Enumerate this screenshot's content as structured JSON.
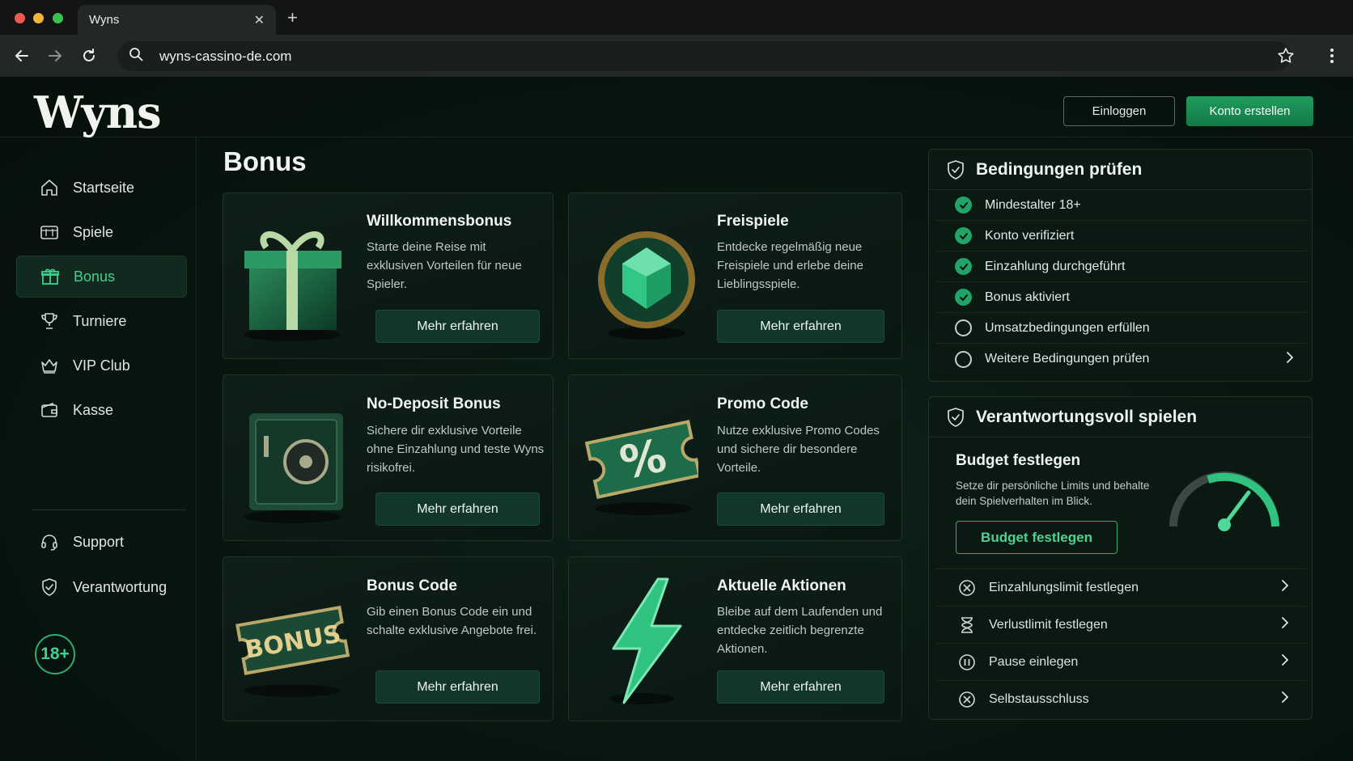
{
  "browser": {
    "tab_title": "Wyns",
    "tab_close": "✕",
    "tab_new": "+",
    "url": "wyns-cassino-de.com"
  },
  "header": {
    "logo": "Wyns",
    "login_label": "Einloggen",
    "signup_label": "Konto erstellen"
  },
  "sidebar": {
    "items": [
      {
        "label": "Startseite",
        "icon": "home-icon"
      },
      {
        "label": "Spiele",
        "icon": "slot-machine-icon"
      },
      {
        "label": "Bonus",
        "icon": "gift-icon",
        "active": true
      },
      {
        "label": "Turniere",
        "icon": "trophy-icon"
      },
      {
        "label": "VIP Club",
        "icon": "crown-icon"
      },
      {
        "label": "Kasse",
        "icon": "wallet-icon"
      },
      {
        "label": "Support",
        "icon": "headset-icon"
      },
      {
        "label": "Verantwortung",
        "icon": "shield-icon"
      }
    ],
    "age_badge": "18+"
  },
  "main": {
    "title": "Bonus",
    "cards": [
      {
        "title": "Willkommensbonus",
        "desc": "Starte deine Reise mit exklusiven Vorteilen für neue Spieler.",
        "button": "Mehr erfahren",
        "art": "gift-box-icon"
      },
      {
        "title": "Freispiele",
        "desc": "Entdecke regelmäßig neue Freispiele und erlebe deine Lieblingsspiele.",
        "button": "Mehr erfahren",
        "art": "emerald-coin-icon"
      },
      {
        "title": "No-Deposit Bonus",
        "desc": "Sichere dir exklusive Vorteile ohne Einzahlung und teste Wyns risikofrei.",
        "button": "Mehr erfahren",
        "art": "safe-icon"
      },
      {
        "title": "Promo Code",
        "desc": "Nutze exklusive Promo Codes und sichere dir besondere Vorteile.",
        "button": "Mehr erfahren",
        "art": "percent-ticket-icon"
      },
      {
        "title": "Bonus Code",
        "desc": "Gib einen Bonus Code ein und schalte exklusive Angebote frei.",
        "button": "Mehr erfahren",
        "art": "bonus-ticket-icon",
        "art_text": "BONUS"
      },
      {
        "title": "Aktuelle Aktionen",
        "desc": "Bleibe auf dem Laufenden und entdecke zeitlich begrenzte Aktionen.",
        "button": "Mehr erfahren",
        "art": "lightning-icon"
      }
    ]
  },
  "conditions": {
    "title": "Bedingungen prüfen",
    "items": [
      {
        "label": "Mindestalter 18+",
        "done": true
      },
      {
        "label": "Konto verifiziert",
        "done": true
      },
      {
        "label": "Einzahlung durchgeführt",
        "done": true
      },
      {
        "label": "Bonus aktiviert",
        "done": true
      },
      {
        "label": "Umsatzbedingungen erfüllen",
        "done": false
      },
      {
        "label": "Weitere Bedingungen prüfen",
        "done": false
      }
    ]
  },
  "responsible": {
    "title": "Verantwortungsvoll spielen",
    "budget_title": "Budget festlegen",
    "budget_desc": "Setze dir persönliche Limits und behalte dein Spielverhalten im Blick.",
    "budget_button": "Budget festlegen",
    "items": [
      {
        "label": "Einzahlungslimit festlegen",
        "icon": "limit-icon"
      },
      {
        "label": "Verlustlimit festlegen",
        "icon": "hourglass-icon"
      },
      {
        "label": "Pause einlegen",
        "icon": "pause-icon"
      },
      {
        "label": "Selbstausschluss",
        "icon": "exclusion-icon"
      }
    ]
  },
  "colors": {
    "accent": "#22a468",
    "background": "#07120e",
    "card": "#0e1f18"
  }
}
